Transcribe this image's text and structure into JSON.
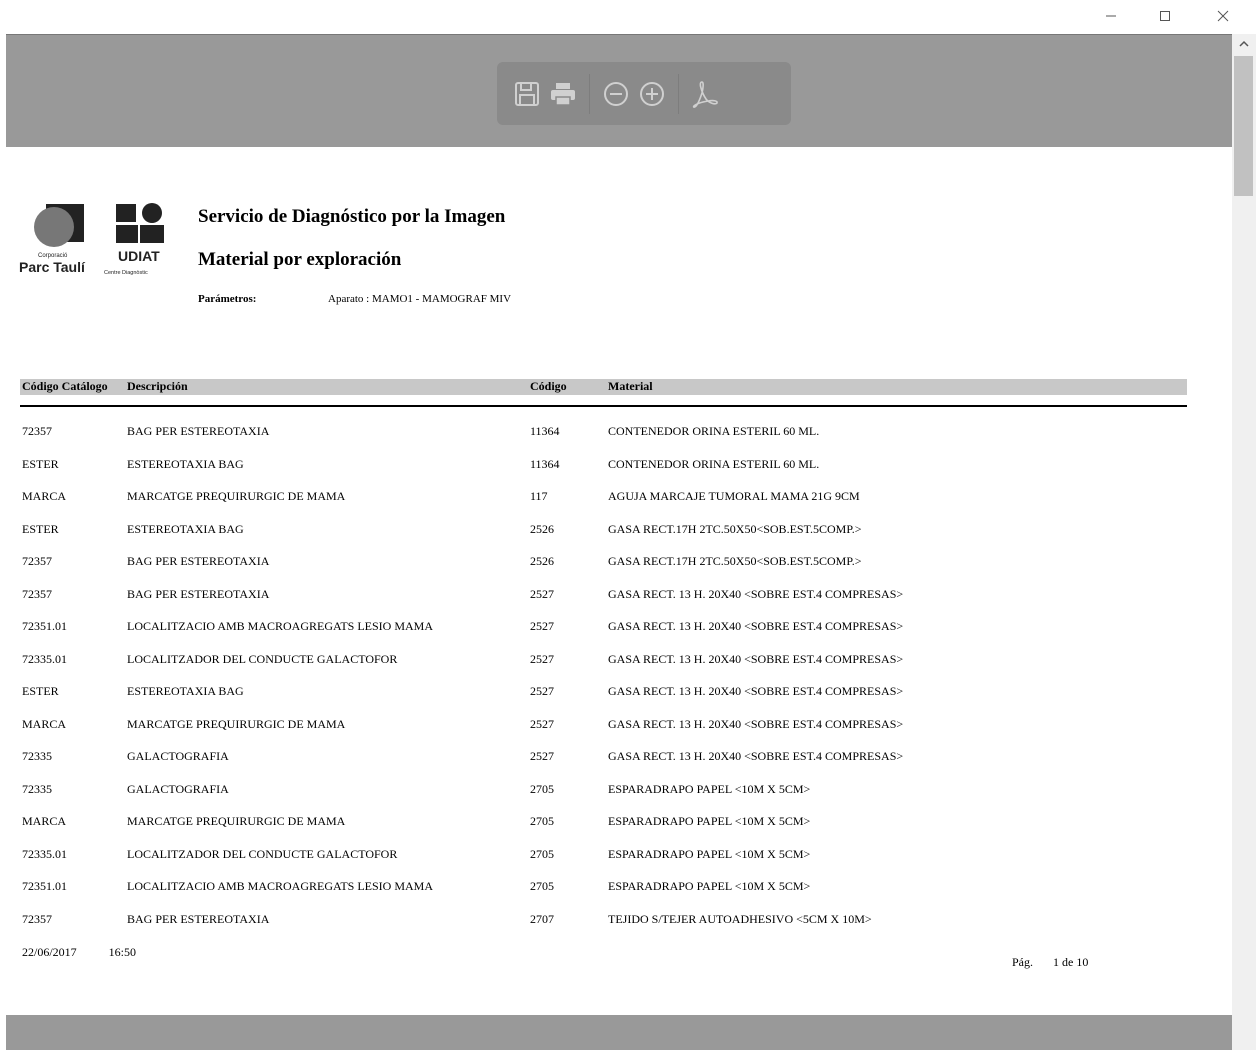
{
  "window": {
    "controls": [
      "minimize-icon",
      "maximize-icon",
      "close-icon"
    ]
  },
  "toolbar": {
    "icons": [
      "save-icon",
      "print-icon",
      "zoom-out-icon",
      "zoom-in-icon",
      "pdf-icon"
    ]
  },
  "report": {
    "logo": {
      "corporacio": "Corporació",
      "parc_tauli": "Parc Taulí",
      "udiat": "UDIAT",
      "centre": "Centre Diagnòstic"
    },
    "title": "Servicio de Diagnóstico por la Imagen",
    "subtitle": "Material por exploración",
    "param_label": "Parámetros:",
    "param_value": "Aparato  : MAMO1 - MAMOGRAF  MIV",
    "columns": [
      "Código Catálogo",
      "Descripción",
      "Código",
      "Material"
    ],
    "rows": [
      [
        "72357",
        "BAG PER ESTEREOTAXIA",
        "11364",
        "CONTENEDOR ORINA ESTERIL 60 ML."
      ],
      [
        "ESTER",
        "ESTEREOTAXIA BAG",
        "11364",
        "CONTENEDOR ORINA ESTERIL 60 ML."
      ],
      [
        "MARCA",
        "MARCATGE PREQUIRURGIC DE MAMA",
        "117",
        "AGUJA MARCAJE TUMORAL MAMA 21G 9CM"
      ],
      [
        "ESTER",
        "ESTEREOTAXIA BAG",
        "2526",
        "GASA RECT.17H 2TC.50X50<SOB.EST.5COMP.>"
      ],
      [
        "72357",
        "BAG PER ESTEREOTAXIA",
        "2526",
        "GASA RECT.17H 2TC.50X50<SOB.EST.5COMP.>"
      ],
      [
        "72357",
        "BAG PER ESTEREOTAXIA",
        "2527",
        "GASA RECT. 13 H. 20X40 <SOBRE EST.4 COMPRESAS>"
      ],
      [
        "72351.01",
        "LOCALITZACIO AMB MACROAGREGATS LESIO MAMA",
        "2527",
        "GASA RECT. 13 H. 20X40 <SOBRE EST.4 COMPRESAS>"
      ],
      [
        "72335.01",
        "LOCALITZADOR DEL CONDUCTE GALACTOFOR",
        "2527",
        "GASA RECT. 13 H. 20X40 <SOBRE EST.4 COMPRESAS>"
      ],
      [
        "ESTER",
        "ESTEREOTAXIA BAG",
        "2527",
        "GASA RECT. 13 H. 20X40 <SOBRE EST.4 COMPRESAS>"
      ],
      [
        "MARCA",
        "MARCATGE PREQUIRURGIC DE MAMA",
        "2527",
        "GASA RECT. 13 H. 20X40 <SOBRE EST.4 COMPRESAS>"
      ],
      [
        "72335",
        "GALACTOGRAFIA",
        "2527",
        "GASA RECT. 13 H. 20X40 <SOBRE EST.4 COMPRESAS>"
      ],
      [
        "72335",
        "GALACTOGRAFIA",
        "2705",
        "ESPARADRAPO PAPEL <10M X 5CM>"
      ],
      [
        "MARCA",
        "MARCATGE PREQUIRURGIC DE MAMA",
        "2705",
        "ESPARADRAPO PAPEL <10M X 5CM>"
      ],
      [
        "72335.01",
        "LOCALITZADOR DEL CONDUCTE GALACTOFOR",
        "2705",
        "ESPARADRAPO PAPEL <10M X 5CM>"
      ],
      [
        "72351.01",
        "LOCALITZACIO AMB MACROAGREGATS LESIO MAMA",
        "2705",
        "ESPARADRAPO PAPEL <10M X 5CM>"
      ],
      [
        "72357",
        "BAG PER ESTEREOTAXIA",
        "2707",
        "TEJIDO S/TEJER AUTOADHESIVO <5CM X 10M>"
      ]
    ],
    "footer": {
      "date": "22/06/2017",
      "time": "16:50",
      "page_label": "Pág.",
      "page_current": "1",
      "page_of": "de",
      "page_total": "10"
    }
  }
}
